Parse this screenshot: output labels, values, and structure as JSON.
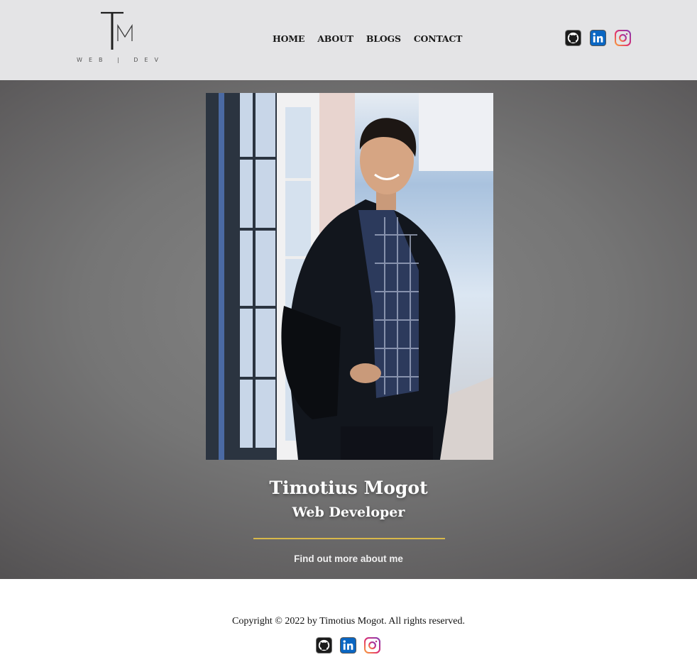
{
  "header": {
    "logo": {
      "letters": "TM",
      "subtitle": "WEB | DEV"
    },
    "nav": [
      {
        "label": "HOME"
      },
      {
        "label": "ABOUT"
      },
      {
        "label": "BLOGS"
      },
      {
        "label": "CONTACT"
      }
    ],
    "social": [
      {
        "icon": "github-icon"
      },
      {
        "icon": "linkedin-icon"
      },
      {
        "icon": "instagram-icon"
      }
    ]
  },
  "hero": {
    "name": "Timotius Mogot",
    "role": "Web Developer",
    "link_label": "Find out more about me",
    "accent_color": "#d8b84a"
  },
  "footer": {
    "copyright": "Copyright © 2022 by Timotius Mogot. All rights reserved.",
    "social": [
      {
        "icon": "github-icon"
      },
      {
        "icon": "linkedin-icon"
      },
      {
        "icon": "instagram-icon"
      }
    ]
  }
}
